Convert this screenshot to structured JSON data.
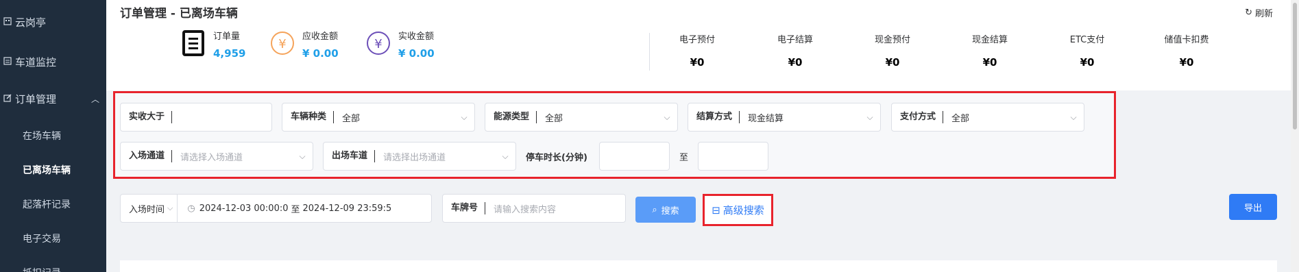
{
  "sidebar": {
    "items": [
      {
        "label": "云岗亭",
        "icon": "building-icon"
      },
      {
        "label": "车道监控",
        "icon": "monitor-icon"
      },
      {
        "label": "订单管理",
        "icon": "edit-icon"
      }
    ],
    "sub_items": [
      "在场车辆",
      "已离场车辆",
      "起落杆记录",
      "电子交易",
      "抵扣记录"
    ],
    "active": "已离场车辆"
  },
  "header": {
    "title": "订单管理 - 已离场车辆",
    "refresh_label": "刷新"
  },
  "stats": [
    {
      "label": "订单量",
      "value": "4,959",
      "icon": "document-icon"
    },
    {
      "label": "应收金额",
      "value": "¥ 0.00",
      "icon": "yen-circle-icon"
    },
    {
      "label": "实收金额",
      "value": "¥ 0.00",
      "icon": "yen-circle-icon"
    }
  ],
  "payments": [
    {
      "label": "电子预付",
      "value": "¥0"
    },
    {
      "label": "电子结算",
      "value": "¥0"
    },
    {
      "label": "现金预付",
      "value": "¥0"
    },
    {
      "label": "现金结算",
      "value": "¥0"
    },
    {
      "label": "ETC支付",
      "value": "¥0"
    },
    {
      "label": "储值卡扣费",
      "value": "¥0"
    }
  ],
  "filters": {
    "paid_gt": {
      "label": "实收大于",
      "value": ""
    },
    "vehicle_type": {
      "label": "车辆种类",
      "value": "全部"
    },
    "energy_type": {
      "label": "能源类型",
      "value": "全部"
    },
    "settle_method": {
      "label": "结算方式",
      "value": "现金结算"
    },
    "pay_method": {
      "label": "支付方式",
      "value": "全部"
    },
    "entry_lane": {
      "label": "入场通道",
      "placeholder": "请选择入场通道"
    },
    "exit_lane": {
      "label": "出场车道",
      "placeholder": "请选择出场通道"
    },
    "duration": {
      "label": "停车时长(分钟)",
      "to": "至"
    }
  },
  "search": {
    "time_type": "入场时间",
    "start": "2024-12-03 00:00:0",
    "sep": "至",
    "end": "2024-12-09 23:59:5",
    "plate_label": "车牌号",
    "plate_placeholder": "请输入搜索内容",
    "search_button": "搜索",
    "advanced_label": "高级搜索",
    "export_button": "导出"
  }
}
